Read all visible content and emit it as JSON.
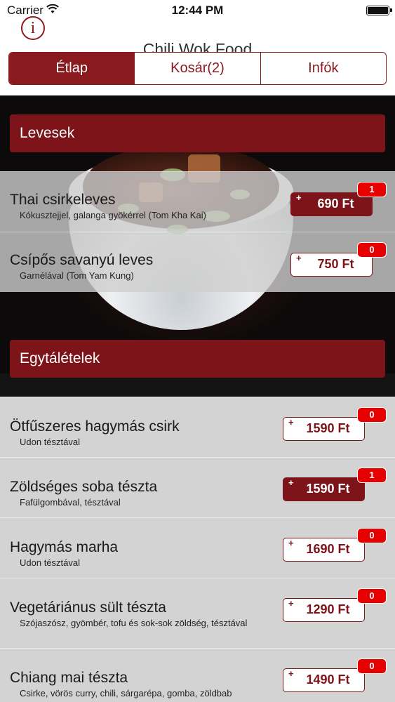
{
  "status_bar": {
    "carrier": "Carrier",
    "time": "12:44 PM"
  },
  "nav": {
    "title": "Chili Wok Food",
    "info_icon": "i"
  },
  "tabs": [
    {
      "label": "Étlap",
      "active": true
    },
    {
      "label": "Kosár(2)",
      "active": false
    },
    {
      "label": "Infók",
      "active": false
    }
  ],
  "sections": [
    {
      "title": "Levesek",
      "items": [
        {
          "name": "Thai csirkeleves",
          "desc": "Kókusztejjel, galanga gyökérrel (Tom Kha Kai)",
          "price": "690 Ft",
          "count": "1",
          "selected": true
        },
        {
          "name": "Csípős savanyú leves",
          "desc": "Garnélával (Tom Yam Kung)",
          "price": "750 Ft",
          "count": "0",
          "selected": false
        }
      ]
    },
    {
      "title": "Egytálételek",
      "items": [
        {
          "name": "Ötfűszeres hagymás csirk",
          "desc": "Udon tésztával",
          "price": "1590 Ft",
          "count": "0",
          "selected": false
        },
        {
          "name": "Zöldséges soba tészta",
          "desc": "Fafülgombával, tésztával",
          "price": "1590 Ft",
          "count": "1",
          "selected": true
        },
        {
          "name": "Hagymás marha",
          "desc": "Udon tésztával",
          "price": "1690 Ft",
          "count": "0",
          "selected": false
        },
        {
          "name": "Vegetáriánus sült tészta",
          "desc": "Szójaszósz, gyömbér, tofu és sok-sok zöldség, tésztával",
          "price": "1290 Ft",
          "count": "0",
          "selected": false
        },
        {
          "name": "Chiang mai tészta",
          "desc": "Csirke, vörös curry, chili, sárgarépa, gomba, zöldbab",
          "price": "1490 Ft",
          "count": "0",
          "selected": false
        }
      ]
    }
  ],
  "colors": {
    "accent": "#7d1419",
    "badge": "#e60000"
  },
  "icons": {
    "plus": "+"
  }
}
